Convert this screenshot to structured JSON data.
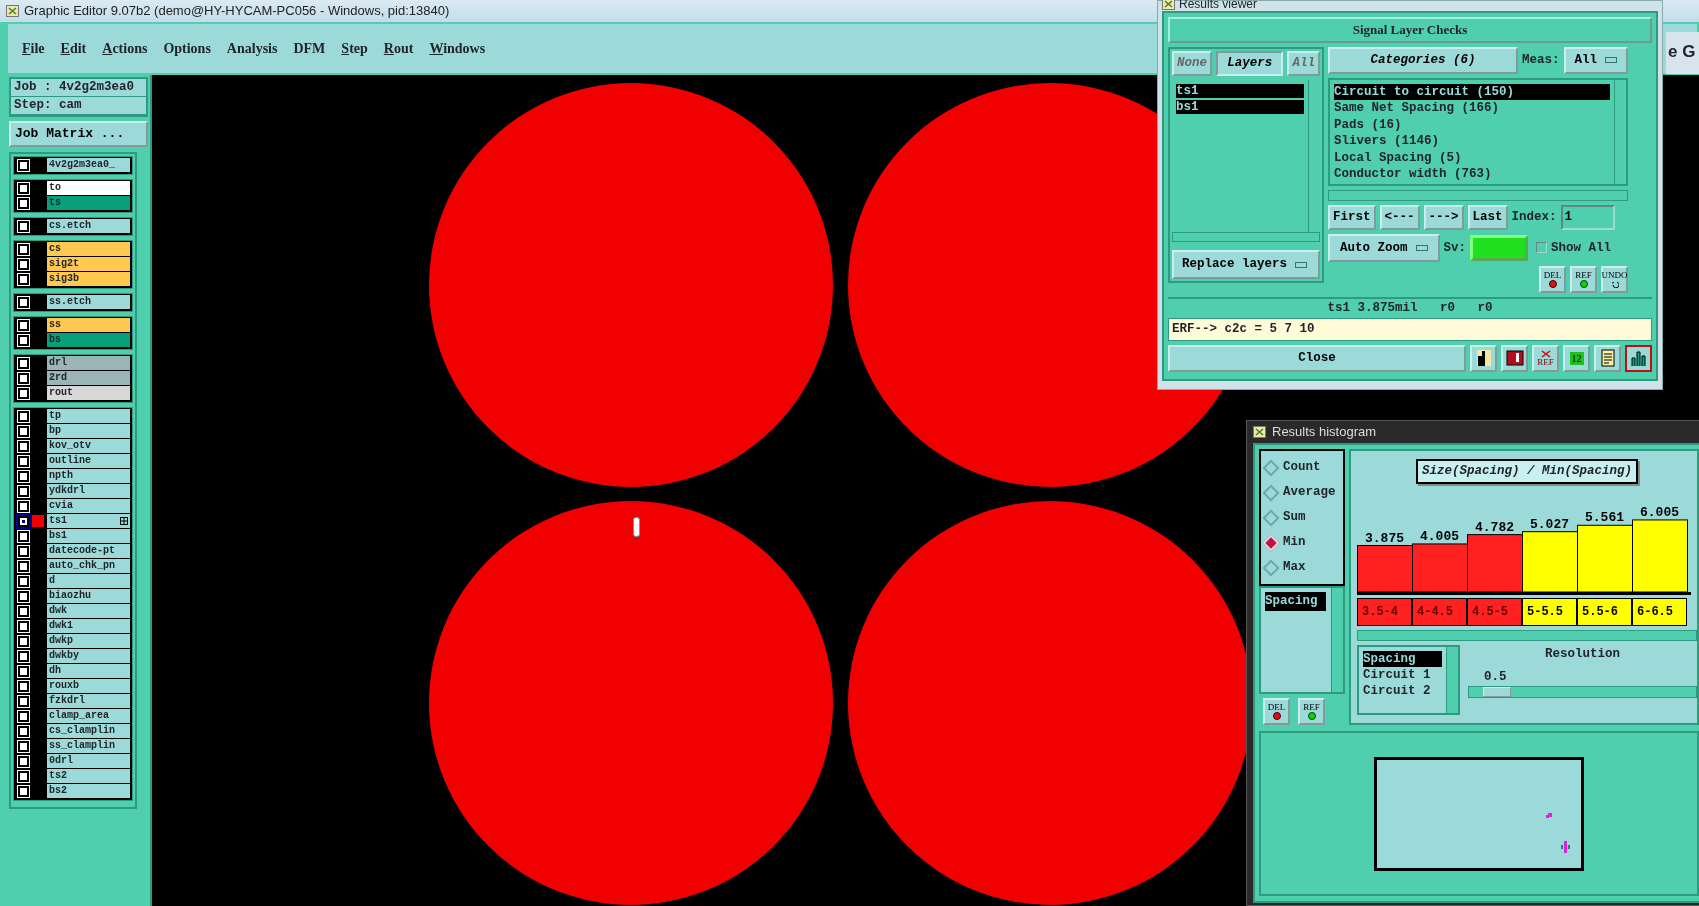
{
  "window": {
    "title": "Graphic Editor 9.07b2 (demo@HY-HYCAM-PC056 - Windows, pid:13840)"
  },
  "menu": [
    {
      "label": "File",
      "underlined": true
    },
    {
      "label": "Edit",
      "underlined": true
    },
    {
      "label": "Actions",
      "underlined": true
    },
    {
      "label": "Options",
      "underlined": false
    },
    {
      "label": "Analysis",
      "underlined": false
    },
    {
      "label": "DFM",
      "underlined": false
    },
    {
      "label": "Step",
      "underlined": true
    },
    {
      "label": "Rout",
      "underlined": true
    },
    {
      "label": "Windows",
      "underlined": true
    }
  ],
  "job": {
    "job_label": "Job : 4v2g2m3ea0",
    "step_label": "Step: cam",
    "matrix_button": "Job Matrix ..."
  },
  "layer_groups": [
    {
      "layers": [
        {
          "name": "4v2g2m3ea0_",
          "color": "#9cdada",
          "selected": false,
          "displayed": false
        }
      ]
    },
    {
      "layers": [
        {
          "name": "to",
          "color": "#ffffff",
          "selected": false,
          "displayed": false
        },
        {
          "name": "ts",
          "color": "#08a07a",
          "selected": false,
          "displayed": false
        }
      ]
    },
    {
      "layers": [
        {
          "name": "cs.etch",
          "color": "#9cdada",
          "selected": false,
          "displayed": false
        }
      ]
    },
    {
      "layers": [
        {
          "name": "cs",
          "color": "#ffc850",
          "selected": false,
          "displayed": false
        },
        {
          "name": "sig2t",
          "color": "#ffc850",
          "selected": false,
          "displayed": false
        },
        {
          "name": "sig3b",
          "color": "#ffc850",
          "selected": false,
          "displayed": false
        }
      ]
    },
    {
      "layers": [
        {
          "name": "ss.etch",
          "color": "#9cdada",
          "selected": false,
          "displayed": false
        }
      ]
    },
    {
      "layers": [
        {
          "name": "ss",
          "color": "#ffc850",
          "selected": false,
          "displayed": false
        },
        {
          "name": "bs",
          "color": "#08a07a",
          "selected": false,
          "displayed": false
        }
      ]
    },
    {
      "layers": [
        {
          "name": "drl",
          "color": "#9ab4b8",
          "selected": false,
          "displayed": false
        },
        {
          "name": "2rd",
          "color": "#9ab4b8",
          "selected": false,
          "displayed": false
        },
        {
          "name": "rout",
          "color": "#d8d8d8",
          "selected": false,
          "displayed": false
        }
      ]
    },
    {
      "layers": [
        {
          "name": "tp",
          "color": "#9cdada",
          "selected": false,
          "displayed": false
        },
        {
          "name": "bp",
          "color": "#9cdada",
          "selected": false,
          "displayed": false
        },
        {
          "name": "kov_otv",
          "color": "#9cdada",
          "selected": false,
          "displayed": false
        },
        {
          "name": "outline",
          "color": "#9cdada",
          "selected": false,
          "displayed": false
        },
        {
          "name": "npth",
          "color": "#9cdada",
          "selected": false,
          "displayed": false
        },
        {
          "name": "ydkdrl",
          "color": "#9cdada",
          "selected": false,
          "displayed": false
        },
        {
          "name": "cvia",
          "color": "#9cdada",
          "selected": false,
          "displayed": false
        },
        {
          "name": "ts1",
          "color": "#9cdada",
          "selected": true,
          "displayed": true
        },
        {
          "name": "bs1",
          "color": "#9cdada",
          "selected": false,
          "displayed": false
        },
        {
          "name": "datecode-pt",
          "color": "#9cdada",
          "selected": false,
          "displayed": false
        },
        {
          "name": "auto_chk_pn",
          "color": "#9cdada",
          "selected": false,
          "displayed": false
        },
        {
          "name": "d",
          "color": "#9cdada",
          "selected": false,
          "displayed": false
        },
        {
          "name": "biaozhu",
          "color": "#9cdada",
          "selected": false,
          "displayed": false
        },
        {
          "name": "dwk",
          "color": "#9cdada",
          "selected": false,
          "displayed": false
        },
        {
          "name": "dwk1",
          "color": "#9cdada",
          "selected": false,
          "displayed": false
        },
        {
          "name": "dwkp",
          "color": "#9cdada",
          "selected": false,
          "displayed": false
        },
        {
          "name": "dwkby",
          "color": "#9cdada",
          "selected": false,
          "displayed": false
        },
        {
          "name": "dh",
          "color": "#9cdada",
          "selected": false,
          "displayed": false
        },
        {
          "name": "rouxb",
          "color": "#9cdada",
          "selected": false,
          "displayed": false
        },
        {
          "name": "fzkdrl",
          "color": "#9cdada",
          "selected": false,
          "displayed": false
        },
        {
          "name": "clamp_area",
          "color": "#9cdada",
          "selected": false,
          "displayed": false
        },
        {
          "name": "cs_clamplin",
          "color": "#9cdada",
          "selected": false,
          "displayed": false
        },
        {
          "name": "ss_clamplin",
          "color": "#9cdada",
          "selected": false,
          "displayed": false
        },
        {
          "name": "0drl",
          "color": "#9cdada",
          "selected": false,
          "displayed": false
        },
        {
          "name": "ts2",
          "color": "#9cdada",
          "selected": false,
          "displayed": false
        },
        {
          "name": "bs2",
          "color": "#9cdada",
          "selected": false,
          "displayed": false
        }
      ]
    }
  ],
  "background_window": {
    "text": "e G"
  },
  "results_viewer": {
    "title": "Results viewer",
    "heading": "Signal Layer Checks",
    "layer_buttons": [
      {
        "label": "None",
        "selected": false
      },
      {
        "label": "Layers",
        "selected": true
      },
      {
        "label": "All",
        "selected": false
      }
    ],
    "layers": [
      {
        "name": "ts1",
        "selected": true
      },
      {
        "name": "bs1",
        "selected": true
      }
    ],
    "categories_button": "Categories (6)",
    "meas_label": "Meas:",
    "meas_value": "All",
    "categories": [
      {
        "label": "Circuit to circuit (150)",
        "selected": true
      },
      {
        "label": "Same Net Spacing (166)",
        "selected": false
      },
      {
        "label": "Pads (16)",
        "selected": false
      },
      {
        "label": "Slivers (1146)",
        "selected": false
      },
      {
        "label": "Local Spacing (5)",
        "selected": false
      },
      {
        "label": "Conductor width (763)",
        "selected": false
      }
    ],
    "nav_buttons": [
      "First",
      "<---",
      "--->",
      "Last"
    ],
    "index_label": "Index:",
    "index_value": "1",
    "zoom_menu": "Auto Zoom",
    "sv_label": "Sv:",
    "show_all": {
      "label": "Show All",
      "checked": false
    },
    "replace_menu": "Replace layers",
    "action_buttons": [
      {
        "kind": "del",
        "label": "DEL"
      },
      {
        "kind": "ref",
        "label": "REF"
      },
      {
        "kind": "undo",
        "label": "UNDO"
      }
    ],
    "status": "ts1 3.875mil   r0   r0",
    "erf": "ERF--> c2c = 5 7 10",
    "close": "Close",
    "tools": [
      {
        "kind": "figure",
        "selected": false
      },
      {
        "kind": "stop",
        "selected": false
      },
      {
        "kind": "ref-cross",
        "label": "REF",
        "selected": false
      },
      {
        "kind": "numbers",
        "label": "12",
        "selected": false
      },
      {
        "kind": "report",
        "selected": false
      },
      {
        "kind": "histogram",
        "selected": true
      }
    ]
  },
  "histogram": {
    "title": "Results histogram",
    "modes": [
      {
        "label": "Count",
        "selected": false
      },
      {
        "label": "Average",
        "selected": false
      },
      {
        "label": "Sum",
        "selected": false
      },
      {
        "label": "Min",
        "selected": true
      },
      {
        "label": "Max",
        "selected": false
      }
    ],
    "measures": [
      {
        "label": "Spacing",
        "selected": true
      }
    ],
    "action_buttons": [
      {
        "kind": "del",
        "label": "DEL"
      },
      {
        "kind": "ref",
        "label": "REF"
      }
    ],
    "bins": [
      {
        "color": "#ff2020"
      },
      {
        "color": "#ff2020"
      },
      {
        "color": "#ff2020"
      },
      {
        "color": "#ffff00"
      },
      {
        "color": "#ffff00"
      },
      {
        "color": "#ffff00"
      }
    ],
    "chart_data": {
      "type": "bar",
      "title": "Size(Spacing) / Min(Spacing)",
      "categories": [
        "3.5-4",
        "4-4.5",
        "4.5-5",
        "5-5.5",
        "5.5-6",
        "6-6.5"
      ],
      "data_labels": true,
      "values": [
        3.875,
        4.005,
        4.782,
        5.027,
        5.561,
        6.005
      ]
    },
    "fields": [
      {
        "label": "Spacing",
        "selected": true
      },
      {
        "label": "Circuit 1",
        "selected": false
      },
      {
        "label": "Circuit 2",
        "selected": false
      }
    ],
    "resolution": {
      "label": "Resolution",
      "value": "0.5",
      "level": 0.06
    }
  }
}
